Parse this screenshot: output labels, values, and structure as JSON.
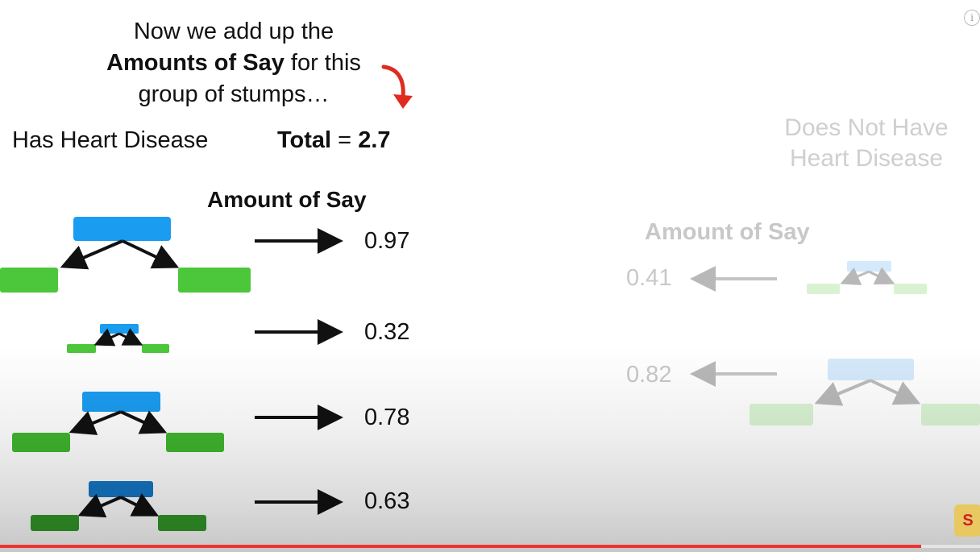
{
  "heading": {
    "line1": "Now we add up the",
    "bold": "Amounts of Say",
    "line2_rest": " for this",
    "line3": "group of stumps…"
  },
  "left_panel": {
    "label": "Has Heart Disease",
    "total_label": "Total",
    "total_eq": " = ",
    "total_value": "2.7",
    "amount_header": "Amount of Say",
    "values": [
      "0.97",
      "0.32",
      "0.78",
      "0.63"
    ]
  },
  "right_panel": {
    "label_line1": "Does Not Have",
    "label_line2": "Heart Disease",
    "amount_header": "Amount of Say",
    "values": [
      "0.41",
      "0.82"
    ]
  },
  "overlay": {
    "info_icon": "i",
    "channel_badge": "S"
  },
  "player": {
    "progress": 0.94
  },
  "colors": {
    "stump_root": "#1a9cf0",
    "stump_leaf": "#4cc63a",
    "arrow_black": "#111111",
    "arrow_red": "#e02b20",
    "faded_text": "#cfcfcf"
  }
}
